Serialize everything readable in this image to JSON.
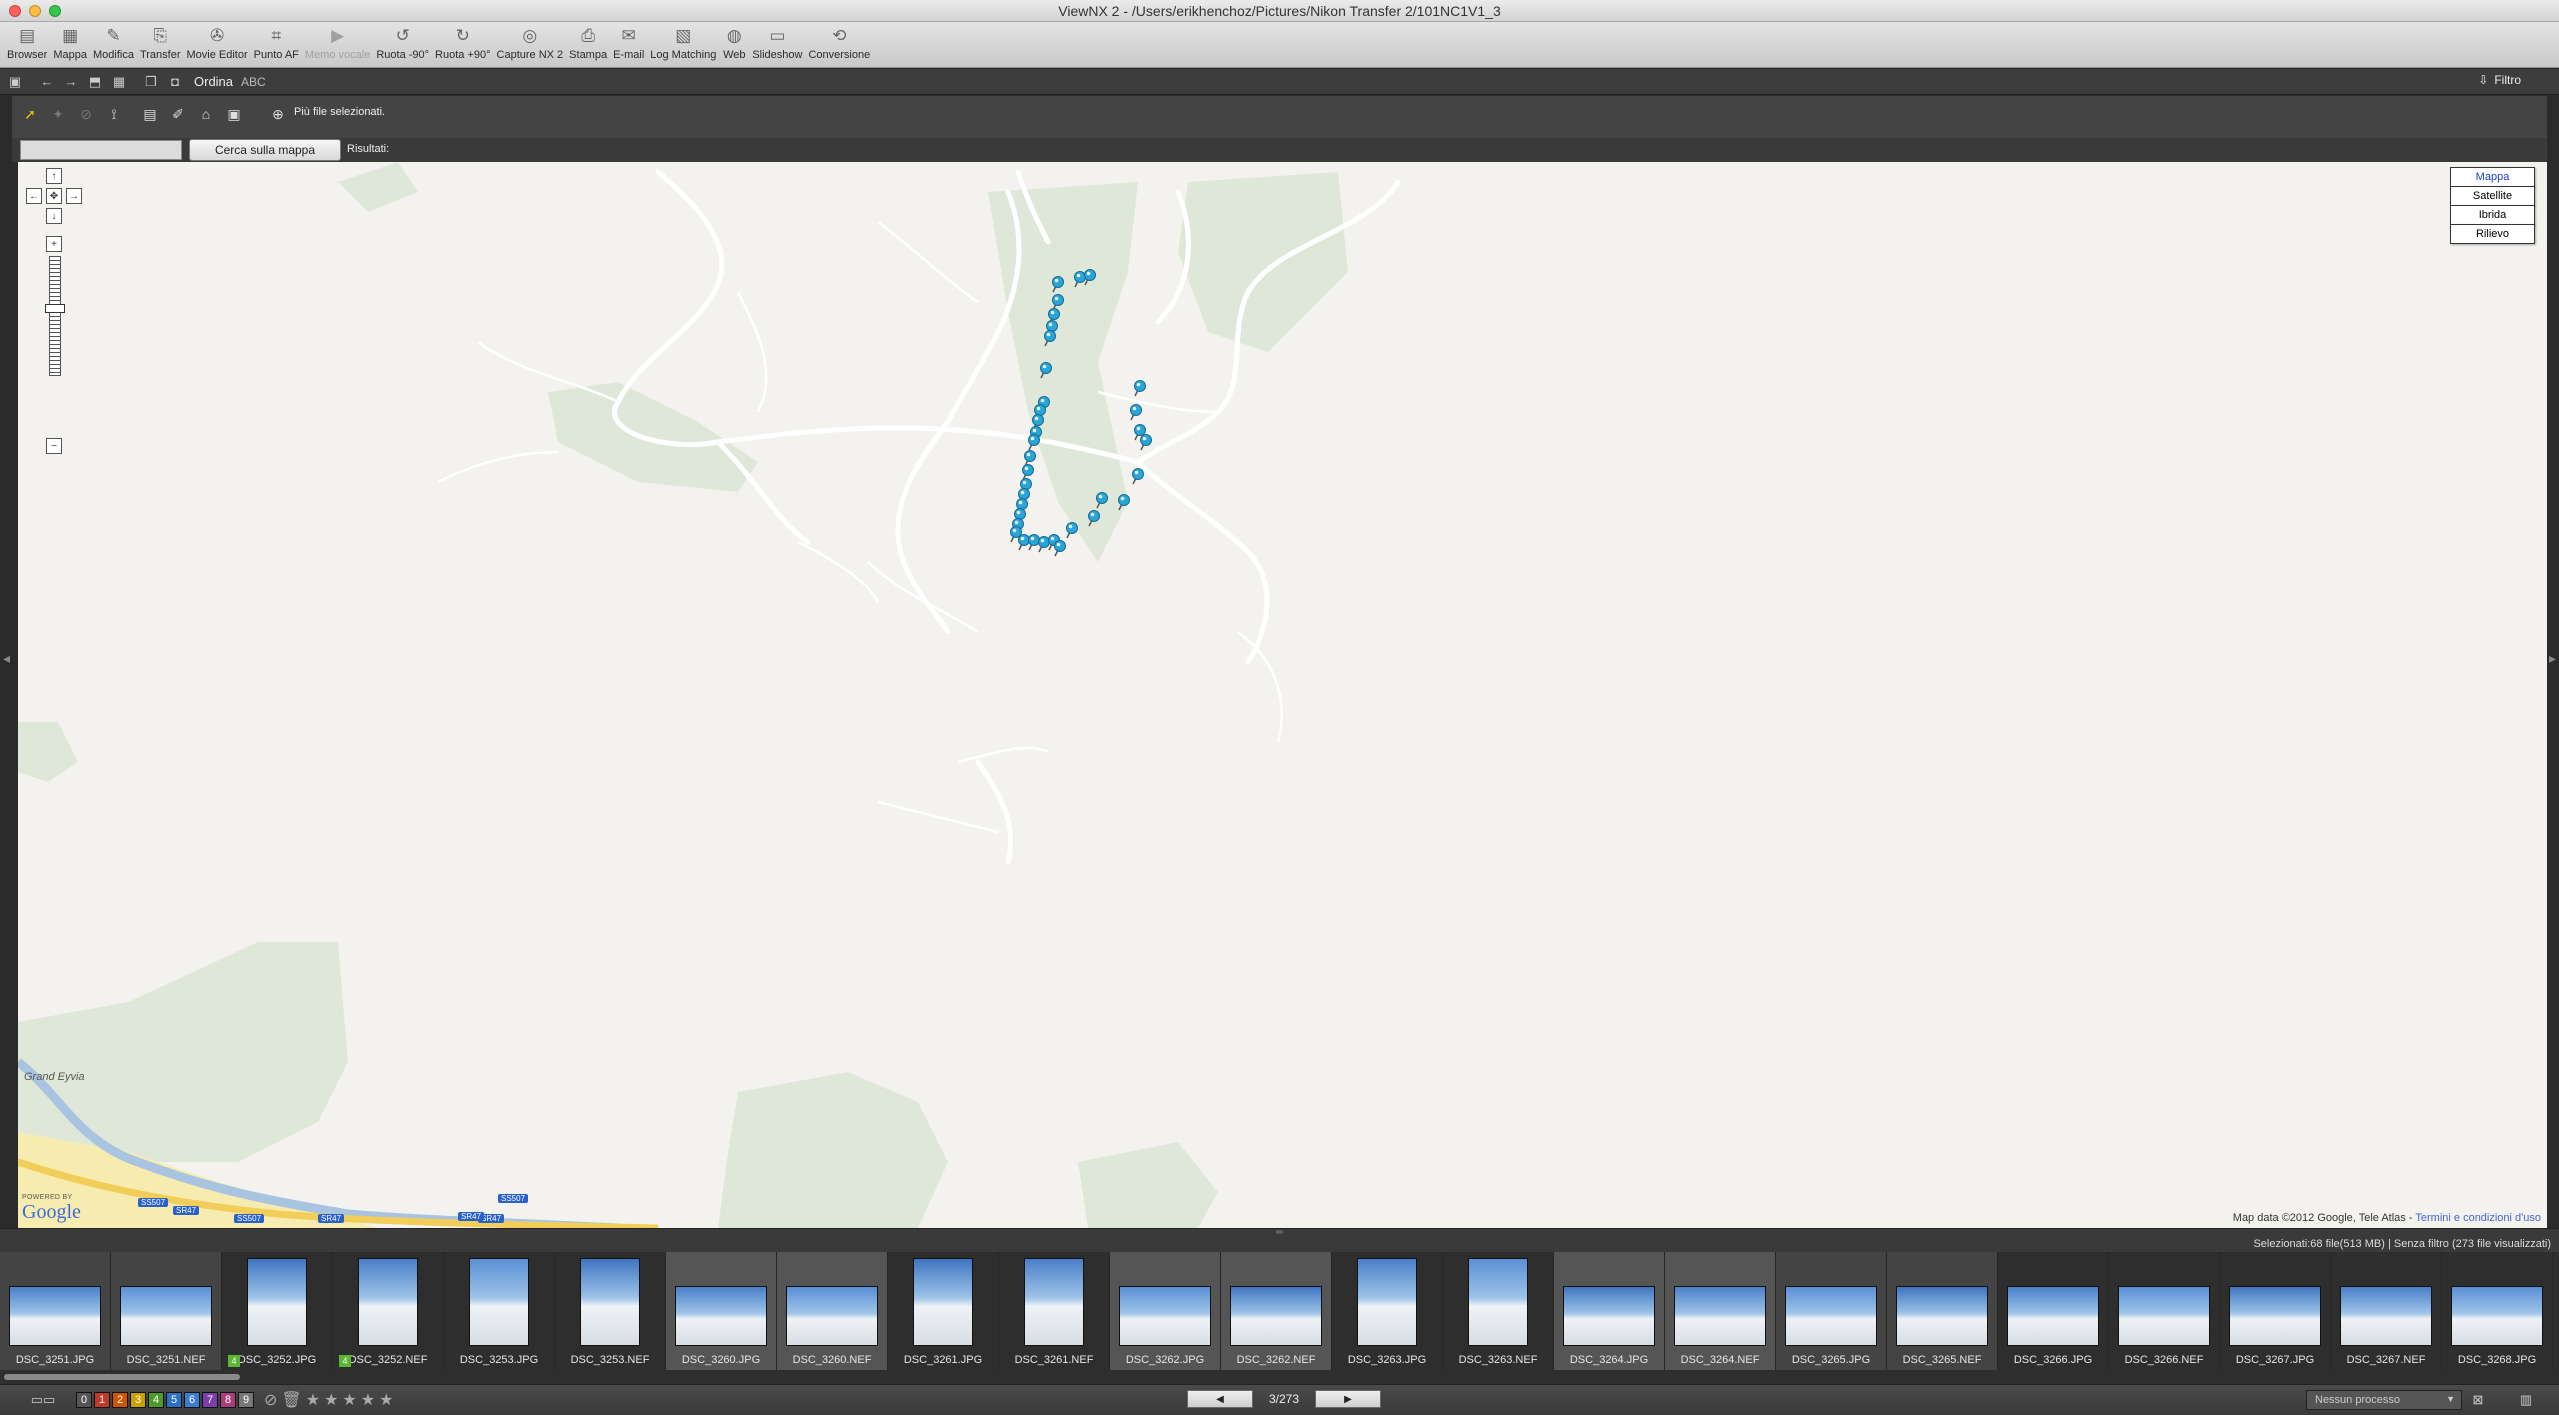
{
  "window": {
    "title": "ViewNX 2 - /Users/erikhenchoz/Pictures/Nikon Transfer 2/101NC1V1_3"
  },
  "toolbar": {
    "items": [
      {
        "label": "Browser",
        "icon": "browser-icon",
        "glyph": "▤",
        "disabled": false
      },
      {
        "label": "Mappa",
        "icon": "map-icon",
        "glyph": "▦",
        "disabled": false
      },
      {
        "label": "Modifica",
        "icon": "edit-icon",
        "glyph": "✎",
        "disabled": false
      },
      {
        "label": "Transfer",
        "icon": "transfer-icon",
        "glyph": "⎘",
        "disabled": false
      },
      {
        "label": "Movie Editor",
        "icon": "movie-editor-icon",
        "glyph": "✇",
        "disabled": false
      },
      {
        "label": "Punto AF",
        "icon": "af-point-icon",
        "glyph": "⌗",
        "disabled": false
      },
      {
        "label": "Memo vocale",
        "icon": "voice-memo-icon",
        "glyph": "▶",
        "disabled": true
      },
      {
        "label": "Ruota -90°",
        "icon": "rotate-left-icon",
        "glyph": "↺",
        "disabled": false
      },
      {
        "label": "Ruota +90°",
        "icon": "rotate-right-icon",
        "glyph": "↻",
        "disabled": false
      },
      {
        "label": "Capture NX 2",
        "icon": "capture-nx-icon",
        "glyph": "◎",
        "disabled": false
      },
      {
        "label": "Stampa",
        "icon": "print-icon",
        "glyph": "⎙",
        "disabled": false
      },
      {
        "label": "E-mail",
        "icon": "email-icon",
        "glyph": "✉",
        "disabled": false
      },
      {
        "label": "Log Matching",
        "icon": "log-matching-icon",
        "glyph": "▧",
        "disabled": false
      },
      {
        "label": "Web",
        "icon": "web-icon",
        "glyph": "◍",
        "disabled": false
      },
      {
        "label": "Slideshow",
        "icon": "slideshow-icon",
        "glyph": "▭",
        "disabled": false
      },
      {
        "label": "Conversione",
        "icon": "conversion-icon",
        "glyph": "⟲",
        "disabled": false
      }
    ]
  },
  "bar2": {
    "sort_label": "Ordina",
    "sort_value": "ABC",
    "filter_label": "Filtro"
  },
  "maptools": {
    "status": "Più file selezionati."
  },
  "search": {
    "button": "Cerca sulla mappa",
    "results_label": "Risultati:",
    "value": "",
    "placeholder": ""
  },
  "map": {
    "types": [
      {
        "label": "Mappa",
        "active": true
      },
      {
        "label": "Satellite",
        "active": false
      },
      {
        "label": "Ibrida",
        "active": false
      },
      {
        "label": "Rilievo",
        "active": false
      }
    ],
    "attribution": "Map data ©2012 Google, Tele Atlas - ",
    "attribution_link": "Termini e condizioni d'uso",
    "powered_by": "POWERED BY",
    "logo": "Google",
    "place_label": "Grand Eyvia",
    "road_badges": [
      "SS507",
      "SR47",
      "SS507",
      "SR47",
      "SR47",
      "SS507",
      "SR47"
    ],
    "pin_color": "#2ba4d8"
  },
  "status": {
    "selection": "Selezionati:68 file(513 MB) | Senza filtro (273 file visualizzati)"
  },
  "filmstrip": [
    {
      "name": "DSC_3251.JPG",
      "orient": "land",
      "state": "cur",
      "badge": ""
    },
    {
      "name": "DSC_3251.NEF",
      "orient": "land",
      "state": "cur",
      "badge": ""
    },
    {
      "name": "DSC_3252.JPG",
      "orient": "port",
      "state": "",
      "badge": "4"
    },
    {
      "name": "DSC_3252.NEF",
      "orient": "port",
      "state": "",
      "badge": "4"
    },
    {
      "name": "DSC_3253.JPG",
      "orient": "port",
      "state": "",
      "badge": ""
    },
    {
      "name": "DSC_3253.NEF",
      "orient": "port",
      "state": "",
      "badge": ""
    },
    {
      "name": "DSC_3260.JPG",
      "orient": "land",
      "state": "sel",
      "badge": ""
    },
    {
      "name": "DSC_3260.NEF",
      "orient": "land",
      "state": "sel",
      "badge": ""
    },
    {
      "name": "DSC_3261.JPG",
      "orient": "port",
      "state": "",
      "badge": ""
    },
    {
      "name": "DSC_3261.NEF",
      "orient": "port",
      "state": "",
      "badge": ""
    },
    {
      "name": "DSC_3262.JPG",
      "orient": "land",
      "state": "sel",
      "badge": ""
    },
    {
      "name": "DSC_3262.NEF",
      "orient": "land",
      "state": "sel",
      "badge": ""
    },
    {
      "name": "DSC_3263.JPG",
      "orient": "port",
      "state": "",
      "badge": ""
    },
    {
      "name": "DSC_3263.NEF",
      "orient": "port",
      "state": "",
      "badge": ""
    },
    {
      "name": "DSC_3264.JPG",
      "orient": "land",
      "state": "sel",
      "badge": ""
    },
    {
      "name": "DSC_3264.NEF",
      "orient": "land",
      "state": "sel",
      "badge": ""
    },
    {
      "name": "DSC_3265.JPG",
      "orient": "land",
      "state": "cur",
      "badge": ""
    },
    {
      "name": "DSC_3265.NEF",
      "orient": "land",
      "state": "cur",
      "badge": ""
    },
    {
      "name": "DSC_3266.JPG",
      "orient": "land",
      "state": "",
      "badge": ""
    },
    {
      "name": "DSC_3266.NEF",
      "orient": "land",
      "state": "",
      "badge": ""
    },
    {
      "name": "DSC_3267.JPG",
      "orient": "land",
      "state": "",
      "badge": ""
    },
    {
      "name": "DSC_3267.NEF",
      "orient": "land",
      "state": "",
      "badge": ""
    },
    {
      "name": "DSC_3268.JPG",
      "orient": "land",
      "state": "",
      "badge": ""
    }
  ],
  "bottombar": {
    "labels": [
      {
        "text": "0",
        "color": "#555555"
      },
      {
        "text": "1",
        "color": "#c0392b"
      },
      {
        "text": "2",
        "color": "#d35400"
      },
      {
        "text": "3",
        "color": "#c8a300"
      },
      {
        "text": "4",
        "color": "#4d9a2a"
      },
      {
        "text": "5",
        "color": "#2d6fc4"
      },
      {
        "text": "6",
        "color": "#3a7ccf"
      },
      {
        "text": "7",
        "color": "#7a3ea8"
      },
      {
        "text": "8",
        "color": "#a83e7a"
      },
      {
        "text": "9",
        "color": "#777777"
      }
    ],
    "page": "3/273",
    "process": "Nessun processo"
  }
}
